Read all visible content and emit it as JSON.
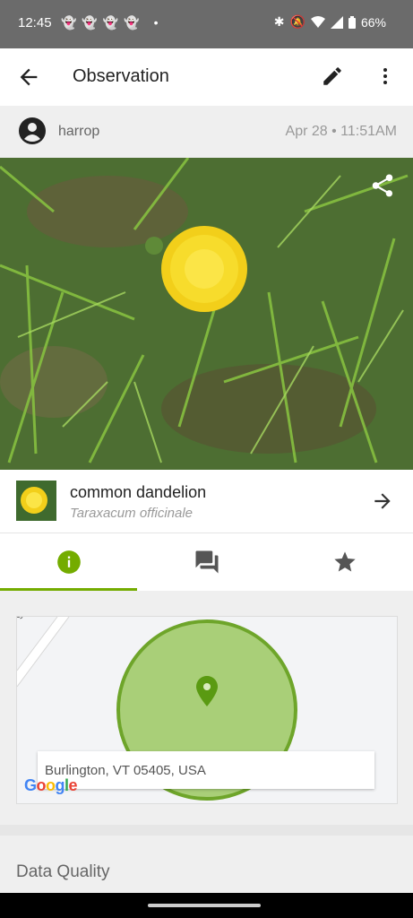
{
  "status_bar": {
    "time": "12:45",
    "notification_icons": [
      "snapchat-icon",
      "snapchat-icon",
      "snapchat-icon",
      "snapchat-icon",
      "dot-icon"
    ],
    "battery": "66%"
  },
  "app_bar": {
    "title": "Observation"
  },
  "observation": {
    "user": "harrop",
    "date": "Apr 28 • 11:51AM"
  },
  "taxon": {
    "common_name": "common dandelion",
    "scientific_name": "Taraxacum officinale"
  },
  "tabs": [
    {
      "name": "info",
      "icon": "info-icon",
      "active": true
    },
    {
      "name": "activity",
      "icon": "chat-icon",
      "active": false
    },
    {
      "name": "favorites",
      "icon": "star-icon",
      "active": false
    }
  ],
  "map": {
    "road_label": "ghts",
    "address": "Burlington, VT 05405, USA",
    "attribution": "Google"
  },
  "sections": {
    "data_quality": "Data Quality"
  },
  "colors": {
    "accent": "#74ac00",
    "circle_fill": "#a9cf78",
    "circle_stroke": "#6ea52a"
  }
}
